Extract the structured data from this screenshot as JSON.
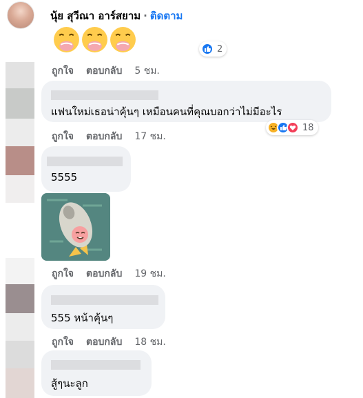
{
  "post": {
    "author": "นุ้ย สุวีณา อาร์สยาม",
    "separator": "·",
    "follow_label": "ติดตาม",
    "emojis": [
      "face-with-hand-over-mouth",
      "face-with-hand-over-mouth",
      "face-with-hand-over-mouth"
    ],
    "reaction_count": "2",
    "actions": {
      "like": "ถูกใจ",
      "reply": "ตอบกลับ",
      "time": "5 ชม."
    }
  },
  "comments": [
    {
      "text": "แฟนใหม่เธอน่าคุ้นๆ เหมือนคนที่คุณบอกว่าไม่มีอะไร",
      "reactions": [
        "haha",
        "like",
        "love"
      ],
      "reaction_count": "18",
      "actions": {
        "like": "ถูกใจ",
        "reply": "ตอบกลับ",
        "time": "17 ชม."
      }
    },
    {
      "text": "5555",
      "sticker": "rocket-sticker",
      "actions": {
        "like": "ถูกใจ",
        "reply": "ตอบกลับ",
        "time": "19 ชม."
      }
    },
    {
      "text": "555 หน้าคุ้นๆ",
      "actions": {
        "like": "ถูกใจ",
        "reply": "ตอบกลับ",
        "time": "18 ชม."
      }
    },
    {
      "text": "สู้ๆนะลูก"
    }
  ],
  "colors": {
    "link": "#1877f2",
    "bubble": "#f0f2f5",
    "meta": "#65676b"
  }
}
